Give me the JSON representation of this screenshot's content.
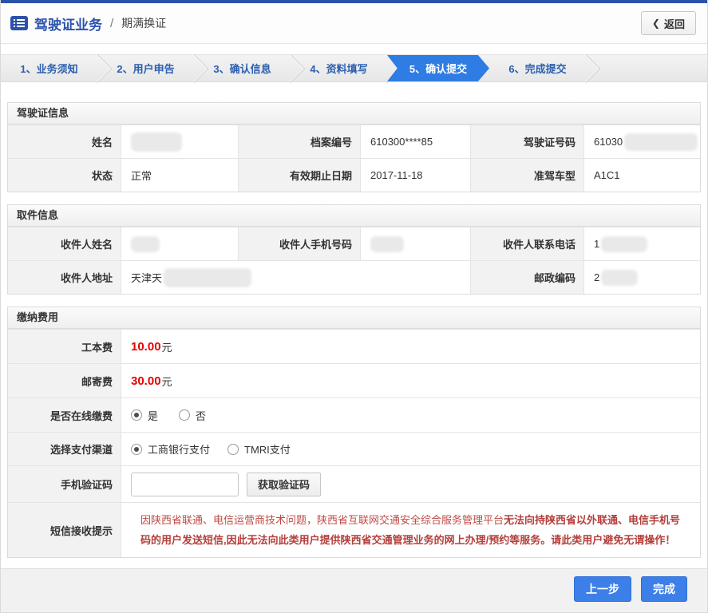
{
  "colors": {
    "navy": "#2b52a8",
    "title_blue": "#2b52ad",
    "accent_blue": "#2e7ce4",
    "step_text": "#2b5fb0",
    "fee_red": "#e60000",
    "warning_red": "#bf4b44",
    "warning_red_bold": "#b43f3c",
    "button_blue": "#3d7fe8"
  },
  "header": {
    "title": "驾驶证业务",
    "separator": "/",
    "subtitle": "期满换证",
    "back_label": "返回",
    "back_chevron": "❮"
  },
  "steps": [
    {
      "label": "1、业务须知",
      "active": false
    },
    {
      "label": "2、用户申告",
      "active": false
    },
    {
      "label": "3、确认信息",
      "active": false
    },
    {
      "label": "4、资料填写",
      "active": false
    },
    {
      "label": "5、确认提交",
      "active": true
    },
    {
      "label": "6、完成提交",
      "active": false
    }
  ],
  "license": {
    "title": "驾驶证信息",
    "fields": {
      "name": {
        "label": "姓名",
        "value": "",
        "redacted": true
      },
      "file_no": {
        "label": "档案编号",
        "value": "610300****85",
        "redacted": false
      },
      "license_no": {
        "label": "驾驶证号码",
        "value": "61030",
        "redacted": true
      },
      "status": {
        "label": "状态",
        "value": "正常",
        "redacted": false
      },
      "expiry": {
        "label": "有效期止日期",
        "value": "2017-11-18",
        "redacted": false
      },
      "vehicle_class": {
        "label": "准驾车型",
        "value": "A1C1",
        "redacted": false
      }
    }
  },
  "pickup": {
    "title": "取件信息",
    "fields": {
      "recipient_name": {
        "label": "收件人姓名",
        "value": "",
        "redacted": true
      },
      "recipient_mobile": {
        "label": "收件人手机号码",
        "value": "",
        "redacted": true
      },
      "recipient_phone": {
        "label": "收件人联系电话",
        "value": "1",
        "redacted": true
      },
      "recipient_address": {
        "label": "收件人地址",
        "value": "天津天",
        "redacted": true
      },
      "postal_code": {
        "label": "邮政编码",
        "value": "2",
        "redacted": true
      }
    }
  },
  "payment": {
    "title": "缴纳费用",
    "work_fee": {
      "label": "工本费",
      "amount": "10.00",
      "unit": "元"
    },
    "mail_fee": {
      "label": "邮寄费",
      "amount": "30.00",
      "unit": "元"
    },
    "online_pay": {
      "label": "是否在线缴费",
      "options": [
        {
          "label": "是",
          "checked": true
        },
        {
          "label": "否",
          "checked": false
        }
      ]
    },
    "channel": {
      "label": "选择支付渠道",
      "options": [
        {
          "label": "工商银行支付",
          "checked": true
        },
        {
          "label": "TMRI支付",
          "checked": false
        }
      ]
    },
    "sms_code": {
      "label": "手机验证码",
      "input_value": "",
      "button_label": "获取验证码"
    },
    "sms_notice": {
      "label": "短信接收提示",
      "text_normal": "因陕西省联通、电信运营商技术问题，陕西省互联网交通安全综合服务管理平台",
      "text_bold": "无法向持陕西省以外联通、电信手机号码的用户发送短信,因此无法向此类用户提供陕西省交通管理业务的网上办理/预约等服务。请此类用户避免无谓操作！"
    }
  },
  "footer": {
    "prev_label": "上一步",
    "finish_label": "完成"
  }
}
